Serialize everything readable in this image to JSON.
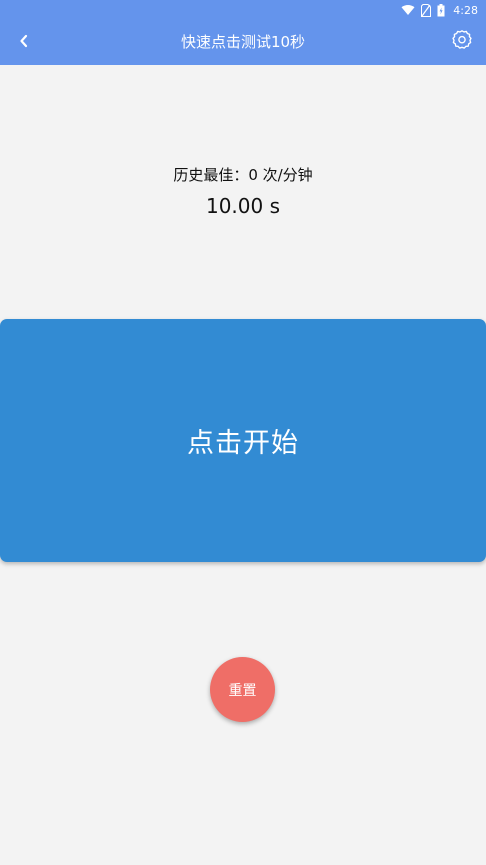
{
  "status_bar": {
    "time": "4:28",
    "icons": [
      "wifi-icon",
      "no-sim-icon",
      "battery-icon"
    ]
  },
  "app_bar": {
    "title": "快速点击测试10秒",
    "back_icon": "chevron-left-icon",
    "settings_icon": "gear-icon"
  },
  "stats": {
    "best_label": "历史最佳：0 次/分钟",
    "timer": "10.00 s"
  },
  "start_button": {
    "label": "点击开始"
  },
  "reset_button": {
    "label": "重置"
  },
  "colors": {
    "app_bar": "#6494ec",
    "start_button": "#328bd3",
    "reset_button": "#ef6e67",
    "background": "#f3f3f3"
  }
}
